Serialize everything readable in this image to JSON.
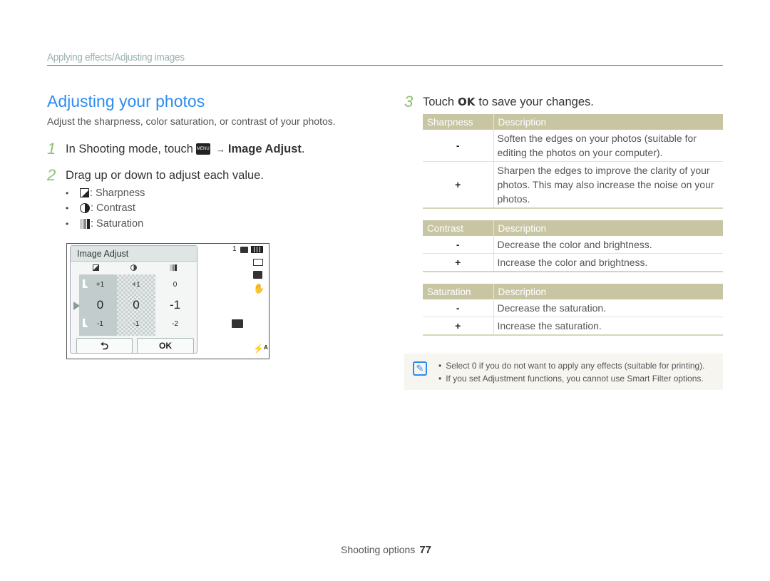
{
  "header": {
    "section": "Applying effects/Adjusting images"
  },
  "main": {
    "title": "Adjusting your photos",
    "intro": "Adjust the sharpness, color saturation, or contrast of your photos.",
    "steps": [
      {
        "num": "1",
        "prefix": "In Shooting mode, touch",
        "key": "MENU",
        "arrow": "→",
        "target": "Image Adjust",
        "suffix": "."
      },
      {
        "num": "2",
        "text": "Drag up or down to adjust each value."
      },
      {
        "num": "3",
        "prefix": "Touch",
        "key": "OK",
        "suffix": "to save your changes."
      }
    ],
    "bullets": [
      {
        "icon": "sharpness-icon",
        "label": ": Sharpness"
      },
      {
        "icon": "contrast-icon",
        "label": ": Contrast"
      },
      {
        "icon": "saturation-icon",
        "label": ": Saturation"
      }
    ]
  },
  "camera_screen": {
    "panel_title": "Image Adjust",
    "columns": [
      {
        "name": "sharpness",
        "above": "+1",
        "current": "0",
        "below": "-1"
      },
      {
        "name": "contrast",
        "above": "+1",
        "current": "0",
        "below": "-1"
      },
      {
        "name": "saturation",
        "above": "0",
        "current": "-1",
        "below": "-2"
      }
    ],
    "back_label": "⮌",
    "ok_label": "OK",
    "status": {
      "shots_remaining": "1",
      "icons": [
        "memory-card-icon",
        "battery-icon",
        "photo-size-icon",
        "quality-icon",
        "stabilization-icon",
        "scene-icon",
        "flash-auto-icon"
      ]
    }
  },
  "tables": [
    {
      "header": [
        "Sharpness",
        "Description"
      ],
      "rows": [
        {
          "sym": "-",
          "desc": "Soften the edges on your photos (suitable for editing the photos on your computer)."
        },
        {
          "sym": "+",
          "desc": "Sharpen the edges to improve the clarity of your photos. This may also increase the noise on your photos."
        }
      ]
    },
    {
      "header": [
        "Contrast",
        "Description"
      ],
      "rows": [
        {
          "sym": "-",
          "desc": "Decrease the color and brightness."
        },
        {
          "sym": "+",
          "desc": "Increase the color and brightness."
        }
      ]
    },
    {
      "header": [
        "Saturation",
        "Description"
      ],
      "rows": [
        {
          "sym": "-",
          "desc": "Decrease the saturation."
        },
        {
          "sym": "+",
          "desc": "Increase the saturation."
        }
      ]
    }
  ],
  "note": {
    "items": [
      "Select 0 if you do not want to apply any effects (suitable for printing).",
      "If you set Adjustment functions, you cannot use Smart Filter options."
    ]
  },
  "footer": {
    "section": "Shooting options",
    "page": "77"
  },
  "colors": {
    "title_blue": "#2d8bf0",
    "step_green": "#8dbf72",
    "table_header": "#c7c5a2"
  }
}
